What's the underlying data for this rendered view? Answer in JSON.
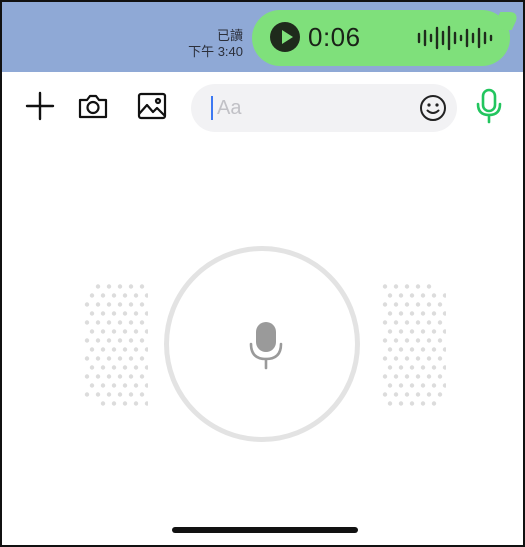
{
  "status": {
    "read_label": "已讀",
    "time": "下午 3:40"
  },
  "voice_message": {
    "duration": "0:06",
    "play_icon": "play-icon",
    "waveform_icon": "waveform-icon"
  },
  "toolbar": {
    "add_icon": "plus-icon",
    "camera_icon": "camera-icon",
    "image_icon": "image-icon",
    "input_placeholder": "Aa",
    "emoji_icon": "smiley-icon",
    "voice_icon": "microphone-icon"
  },
  "recorder": {
    "mic_icon": "microphone-icon",
    "ring_color": "#e3e3e3",
    "dot_color": "#dcdcdc"
  },
  "colors": {
    "chat_background": "#8fa9d6",
    "bubble_green": "#7fe07b",
    "accent_green": "#22c55e",
    "caret_blue": "#3c78f2"
  }
}
